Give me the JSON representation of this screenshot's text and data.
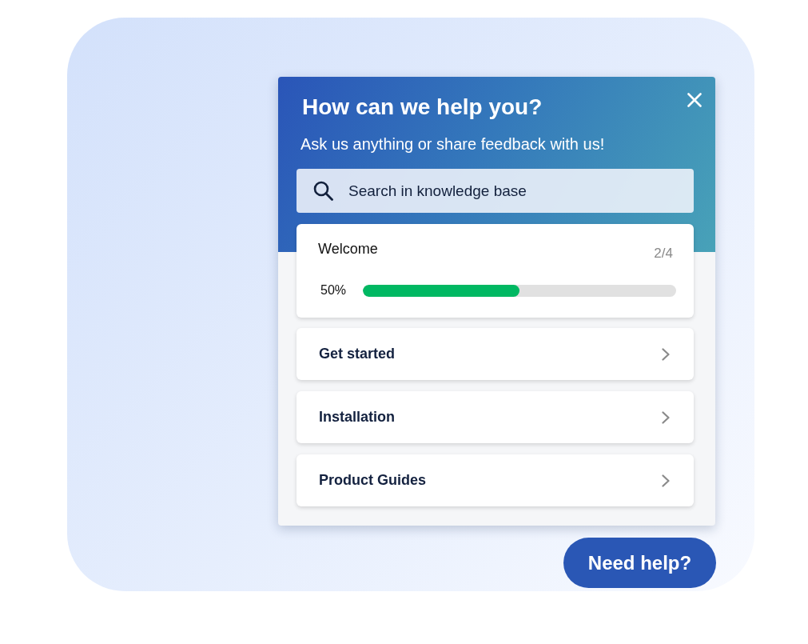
{
  "panel": {
    "title": "How can we help you?",
    "subtitle": "Ask us anything or share feedback with us!",
    "search": {
      "placeholder": "Search in knowledge base"
    },
    "progress_card": {
      "title": "Welcome",
      "step": "2/4",
      "percent": "50%",
      "level": 0.5
    },
    "items": [
      {
        "label": "Get started"
      },
      {
        "label": "Installation"
      },
      {
        "label": "Product Guides"
      }
    ]
  },
  "help_button": {
    "label": "Need help?"
  }
}
